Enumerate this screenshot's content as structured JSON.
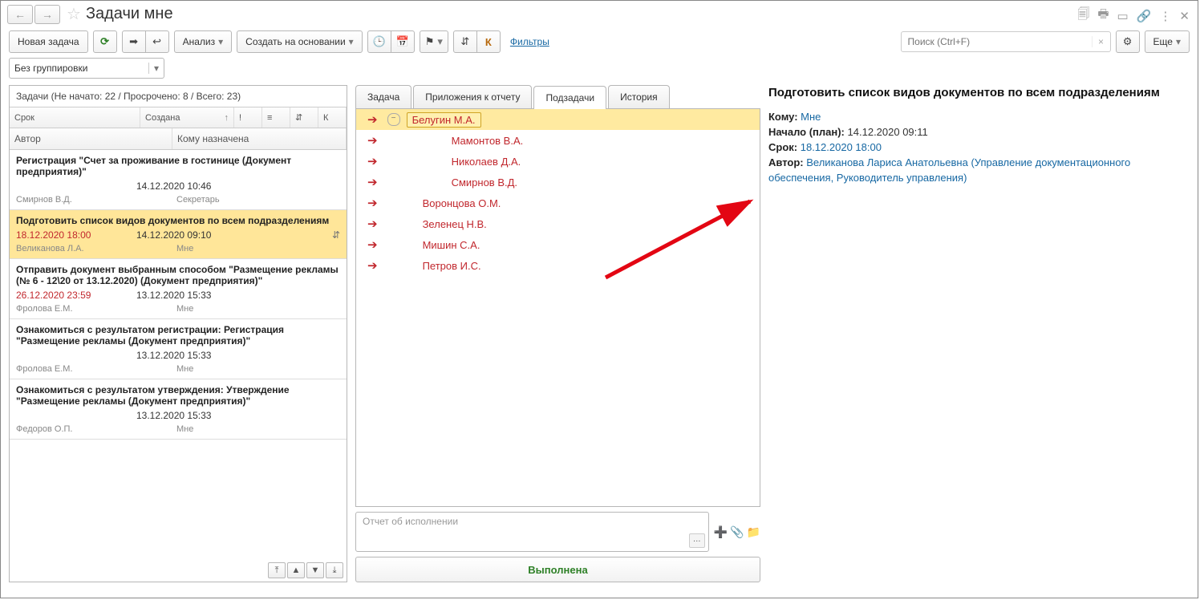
{
  "title": "Задачи мне",
  "toolbar": {
    "new_task": "Новая задача",
    "analysis": "Анализ",
    "create_based_on": "Создать на основании",
    "filters": "Фильтры",
    "search_ph": "Поиск (Ctrl+F)",
    "more": "Еще"
  },
  "grouping": "Без группировки",
  "left": {
    "summary": "Задачи (Не начато: 22 / Просрочено: 8 / Всего: 23)",
    "col_srok": "Срок",
    "col_created": "Создана",
    "col_author": "Автор",
    "col_assigned": "Кому назначена",
    "mini_k": "К",
    "tasks": [
      {
        "title": "Регистрация \"Счет за проживание в гостинице (Документ предприятия)\"",
        "deadline": "",
        "created": "14.12.2020 10:46",
        "author": "Смирнов В.Д.",
        "assignee": "Секретарь",
        "red": false,
        "sel": false,
        "icons": ""
      },
      {
        "title": "Подготовить список видов документов по всем подразделениям",
        "deadline": "18.12.2020 18:00",
        "created": "14.12.2020 09:10",
        "author": "Великанова Л.А.",
        "assignee": "Мне",
        "red": true,
        "sel": true,
        "icons": "tree"
      },
      {
        "title": "Отправить документ выбранным способом \"Размещение рекламы (№ 6 - 12\\20 от 13.12.2020) (Документ предприятия)\"",
        "deadline": "26.12.2020 23:59",
        "created": "13.12.2020 15:33",
        "author": "Фролова Е.М.",
        "assignee": "Мне",
        "red": true,
        "sel": false,
        "icons": ""
      },
      {
        "title": "Ознакомиться с результатом регистрации: Регистрация \"Размещение рекламы (Документ предприятия)\"",
        "deadline": "",
        "created": "13.12.2020 15:33",
        "author": "Фролова Е.М.",
        "assignee": "Мне",
        "red": false,
        "sel": false,
        "icons": ""
      },
      {
        "title": "Ознакомиться с результатом утверждения: Утверждение \"Размещение рекламы (Документ предприятия)\"",
        "deadline": "",
        "created": "13.12.2020 15:33",
        "author": "Федоров О.П.",
        "assignee": "Мне",
        "red": false,
        "sel": false,
        "icons": ""
      }
    ]
  },
  "tabs": {
    "task": "Задача",
    "attach": "Приложения к отчету",
    "sub": "Подзадачи",
    "hist": "История"
  },
  "subtasks": [
    {
      "name": "Белугин М.А.",
      "level": 1,
      "sel": true,
      "expand": true
    },
    {
      "name": "Мамонтов В.А.",
      "level": 3
    },
    {
      "name": "Николаев Д.А.",
      "level": 3
    },
    {
      "name": "Смирнов В.Д.",
      "level": 3
    },
    {
      "name": "Воронцова О.М.",
      "level": 2
    },
    {
      "name": "Зеленец Н.В.",
      "level": 2
    },
    {
      "name": "Мишин С.А.",
      "level": 2
    },
    {
      "name": "Петров И.С.",
      "level": 2
    }
  ],
  "comment_ph": "Отчет об исполнении",
  "done_btn": "Выполнена",
  "right": {
    "title": "Подготовить список видов документов по всем подразделениям",
    "to_l": "Кому:",
    "to_v": "Мне",
    "start_l": "Начало (план):",
    "start_v": "14.12.2020 09:11",
    "deadline_l": "Срок:",
    "deadline_v": "18.12.2020 18:00",
    "author_l": "Автор:",
    "author_v": "Великанова Лариса Анатольевна (Управление документационного обеспечения, Руководитель управления)"
  }
}
